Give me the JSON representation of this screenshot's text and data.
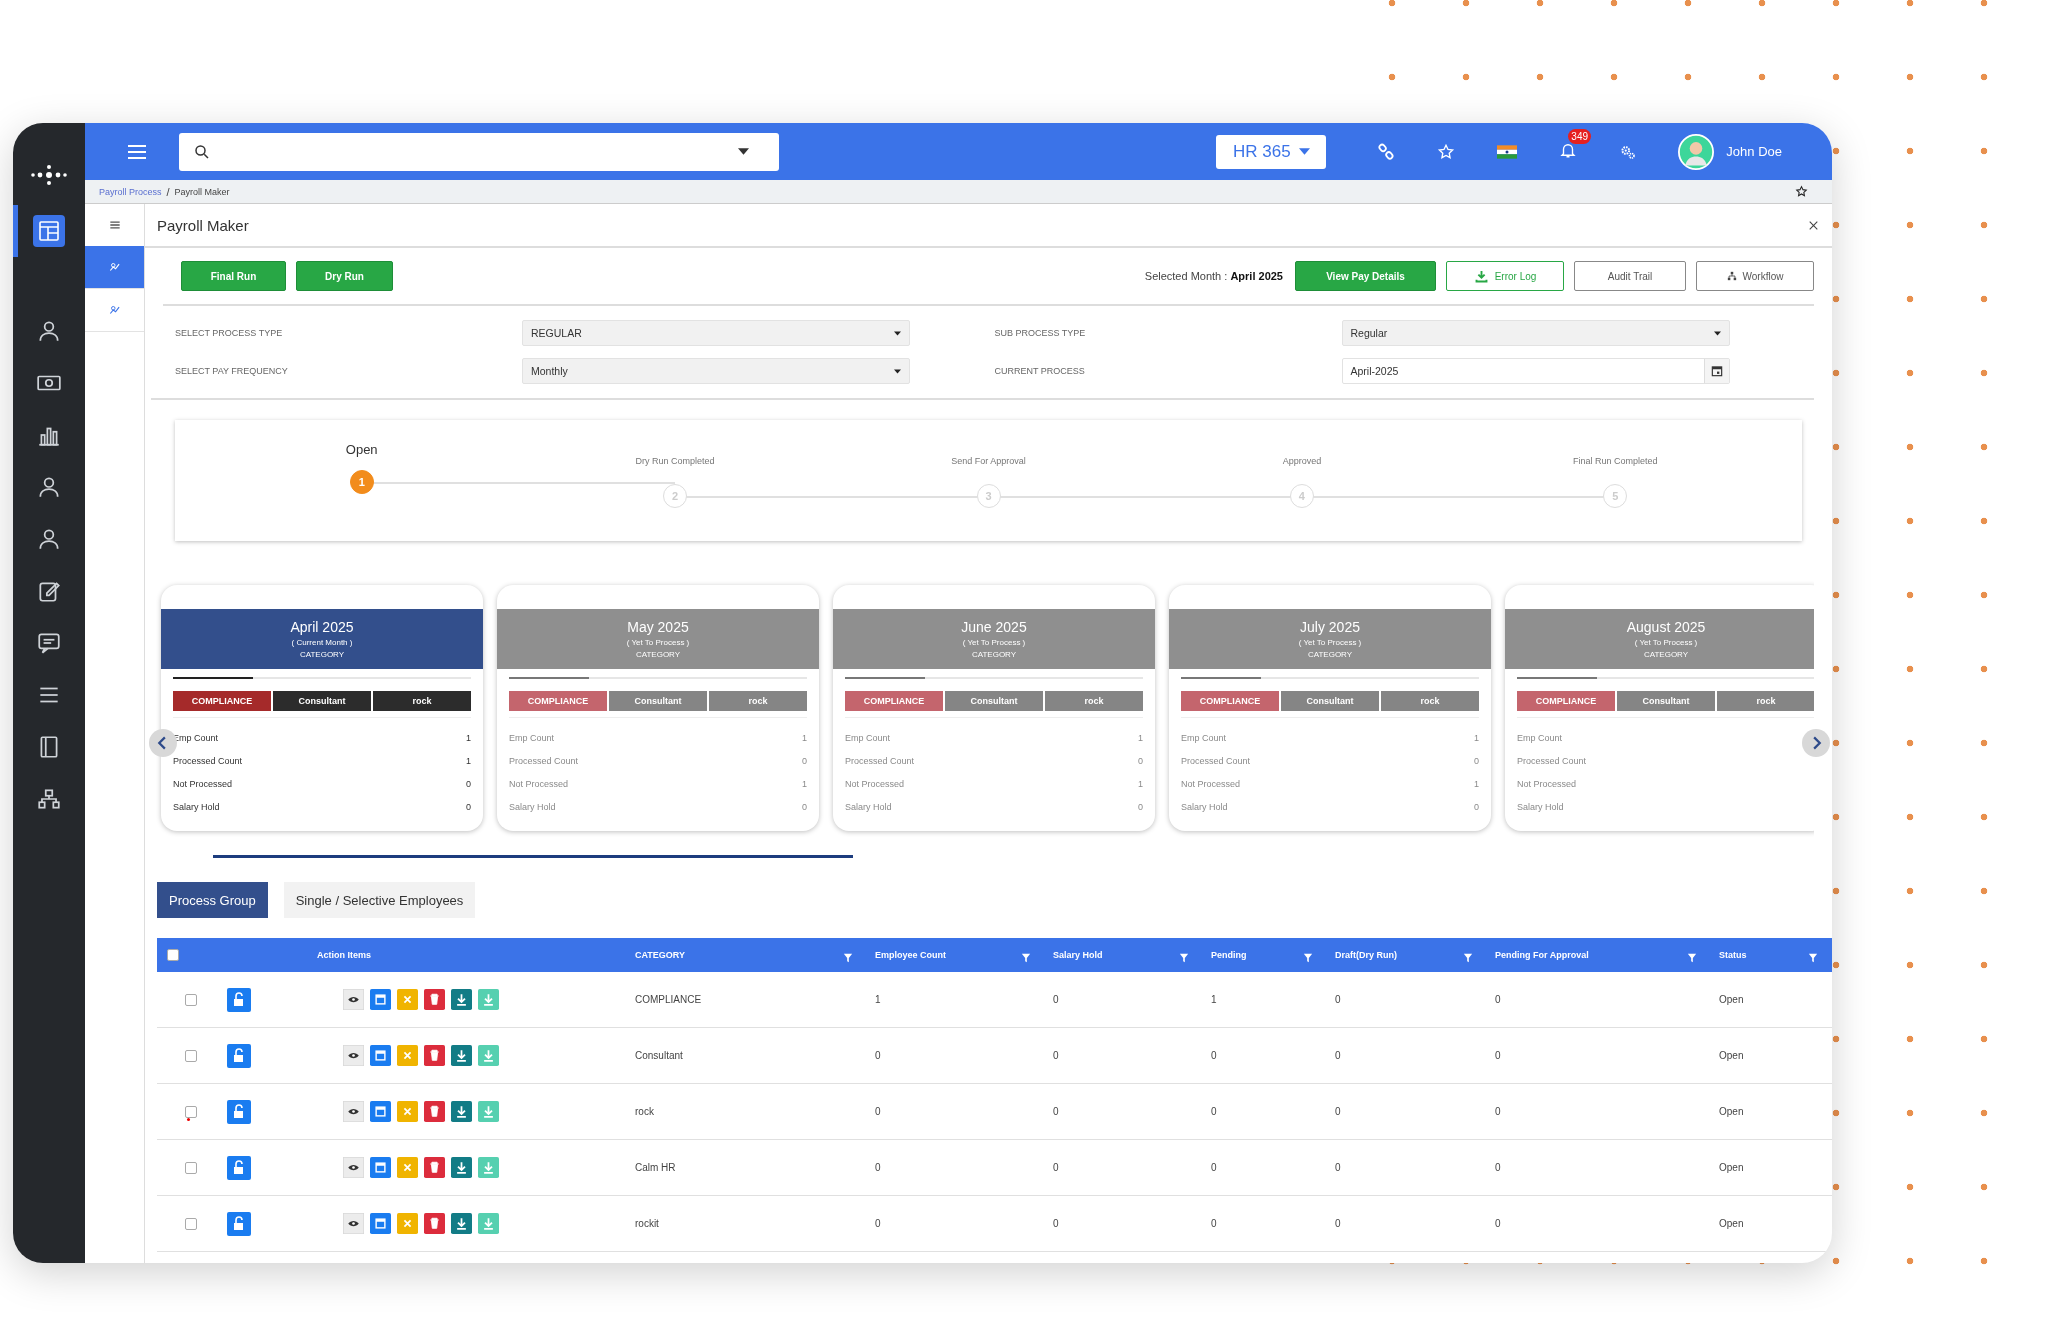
{
  "sidebar": {
    "items": [
      {
        "selected": true
      },
      {
        "selected": false
      },
      {
        "selected": false
      },
      {
        "selected": false
      },
      {
        "selected": false
      },
      {
        "selected": false
      },
      {
        "selected": false
      },
      {
        "selected": false
      },
      {
        "selected": false
      },
      {
        "selected": false
      },
      {
        "selected": false
      }
    ]
  },
  "topbar": {
    "product": "HR 365",
    "notifications": "349",
    "user": "John Doe"
  },
  "breadcrumb": {
    "separator": "/",
    "items": [
      {
        "label": "Payroll Process",
        "kind": "link"
      },
      {
        "label": "Payroll Maker",
        "kind": "current"
      }
    ]
  },
  "subnav": {
    "items": [
      {
        "selected": true
      },
      {
        "selected": false
      }
    ]
  },
  "page_title": "Payroll Maker",
  "run_buttons": [
    "Final Run",
    "Dry Run"
  ],
  "selected_month": {
    "label": "Selected Month :",
    "value": "April 2025"
  },
  "actions": [
    {
      "label": "View Pay Details",
      "kind": "solid"
    },
    {
      "label": "Error Log",
      "kind": "download"
    },
    {
      "label": "Audit Trail",
      "kind": "plain"
    },
    {
      "label": "Workflow",
      "kind": "workflow"
    }
  ],
  "fields": [
    {
      "label": "SELECT PROCESS TYPE",
      "value": "REGULAR",
      "kind": "select"
    },
    {
      "label": "SUB PROCESS TYPE",
      "value": "Regular",
      "kind": "select"
    },
    {
      "label": "SELECT PAY FREQUENCY",
      "value": "Monthly",
      "kind": "select"
    },
    {
      "label": "CURRENT PROCESS",
      "value": "April-2025",
      "kind": "date"
    }
  ],
  "steps": [
    {
      "label": "Open",
      "number": "1",
      "selected": true
    },
    {
      "label": "Dry Run Completed",
      "number": "2",
      "selected": false
    },
    {
      "label": "Send For Approval",
      "number": "3",
      "selected": false
    },
    {
      "label": "Approved",
      "number": "4",
      "selected": false
    },
    {
      "label": "Final Run Completed",
      "number": "5",
      "selected": false
    }
  ],
  "cards": [
    {
      "month": "April 2025",
      "note": "( Current Month )",
      "heading": "CATEGORY",
      "selected": true,
      "tags": [
        {
          "label": "COMPLIANCE",
          "kind": "compliance"
        },
        {
          "label": "Consultant",
          "kind": "other"
        },
        {
          "label": "rock",
          "kind": "other"
        }
      ],
      "stats": [
        {
          "label": "Emp Count",
          "value": "1"
        },
        {
          "label": "Processed Count",
          "value": "1"
        },
        {
          "label": "Not Processed",
          "value": "0"
        },
        {
          "label": "Salary Hold",
          "value": "0"
        }
      ]
    },
    {
      "month": "May 2025",
      "note": "( Yet To Process )",
      "heading": "CATEGORY",
      "selected": false,
      "tags": [
        {
          "label": "COMPLIANCE",
          "kind": "compliance"
        },
        {
          "label": "Consultant",
          "kind": "other"
        },
        {
          "label": "rock",
          "kind": "other"
        }
      ],
      "stats": [
        {
          "label": "Emp Count",
          "value": "1"
        },
        {
          "label": "Processed Count",
          "value": "0"
        },
        {
          "label": "Not Processed",
          "value": "1"
        },
        {
          "label": "Salary Hold",
          "value": "0"
        }
      ]
    },
    {
      "month": "June 2025",
      "note": "( Yet To Process )",
      "heading": "CATEGORY",
      "selected": false,
      "tags": [
        {
          "label": "COMPLIANCE",
          "kind": "compliance"
        },
        {
          "label": "Consultant",
          "kind": "other"
        },
        {
          "label": "rock",
          "kind": "other"
        }
      ],
      "stats": [
        {
          "label": "Emp Count",
          "value": "1"
        },
        {
          "label": "Processed Count",
          "value": "0"
        },
        {
          "label": "Not Processed",
          "value": "1"
        },
        {
          "label": "Salary Hold",
          "value": "0"
        }
      ]
    },
    {
      "month": "July 2025",
      "note": "( Yet To Process )",
      "heading": "CATEGORY",
      "selected": false,
      "tags": [
        {
          "label": "COMPLIANCE",
          "kind": "compliance"
        },
        {
          "label": "Consultant",
          "kind": "other"
        },
        {
          "label": "rock",
          "kind": "other"
        }
      ],
      "stats": [
        {
          "label": "Emp Count",
          "value": "1"
        },
        {
          "label": "Processed Count",
          "value": "0"
        },
        {
          "label": "Not Processed",
          "value": "1"
        },
        {
          "label": "Salary Hold",
          "value": "0"
        }
      ]
    },
    {
      "month": "August 2025",
      "note": "( Yet To Process )",
      "heading": "CATEGORY",
      "selected": false,
      "tags": [
        {
          "label": "COMPLIANCE",
          "kind": "compliance"
        },
        {
          "label": "Consultant",
          "kind": "other"
        },
        {
          "label": "rock",
          "kind": "other"
        }
      ],
      "stats": [
        {
          "label": "Emp Count"
        },
        {
          "label": "Processed Count"
        },
        {
          "label": "Not Processed"
        },
        {
          "label": "Salary Hold"
        }
      ]
    }
  ],
  "view_tabs": [
    {
      "label": "Process Group",
      "selected": true
    },
    {
      "label": "Single / Selective Employees",
      "selected": false
    }
  ],
  "table": {
    "all_checked": false,
    "columns": [
      {
        "label": "Action Items",
        "filter": false
      },
      {
        "label": "CATEGORY",
        "filter": true
      },
      {
        "label": "Employee Count",
        "filter": true
      },
      {
        "label": "Salary Hold",
        "filter": true
      },
      {
        "label": "Pending",
        "filter": true
      },
      {
        "label": "Draft(Dry Run)",
        "filter": true
      },
      {
        "label": "Pending For Approval",
        "filter": true
      },
      {
        "label": "Status",
        "filter": true
      }
    ],
    "rows": [
      {
        "checked": false,
        "marked": false,
        "cells": [
          "",
          "COMPLIANCE",
          "1",
          "0",
          "1",
          "0",
          "0",
          "Open"
        ]
      },
      {
        "checked": false,
        "marked": false,
        "cells": [
          "",
          "Consultant",
          "0",
          "0",
          "0",
          "0",
          "0",
          "Open"
        ]
      },
      {
        "checked": false,
        "marked": true,
        "cells": [
          "",
          "rock",
          "0",
          "0",
          "0",
          "0",
          "0",
          "Open"
        ]
      },
      {
        "checked": false,
        "marked": false,
        "cells": [
          "",
          "Calm HR",
          "0",
          "0",
          "0",
          "0",
          "0",
          "Open"
        ]
      },
      {
        "checked": false,
        "marked": false,
        "cells": [
          "",
          "rockit",
          "0",
          "0",
          "0",
          "0",
          "0",
          "Open"
        ]
      }
    ]
  }
}
